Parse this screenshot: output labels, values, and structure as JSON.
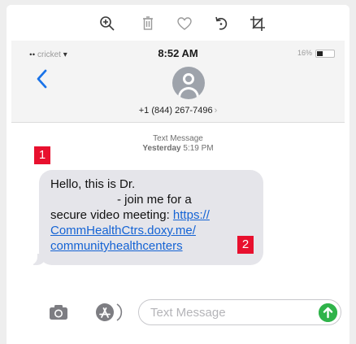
{
  "toolbar": {
    "icons": [
      "zoom-in-icon",
      "trash-icon",
      "heart-icon",
      "rotate-icon",
      "crop-icon"
    ]
  },
  "status_bar": {
    "carrier": "cricket",
    "time": "8:52 AM",
    "battery_percent": "16%"
  },
  "contact": {
    "phone_number": "+1 (844) 267-7496",
    "chevron": "›"
  },
  "thread": {
    "label": "Text Message",
    "day": "Yesterday",
    "time": "5:19 PM"
  },
  "message": {
    "line1": "Hello, this is Dr.",
    "line2": "- join me for a",
    "line3_text": "secure video meeting: ",
    "line3_link": "https://",
    "line4_link": "CommHealthCtrs.doxy.me/",
    "line5_link": "communityhealthcenters"
  },
  "annotations": {
    "badge1": "1",
    "badge2": "2",
    "color": "#e8102e"
  },
  "composer": {
    "placeholder": "Text Message",
    "send_color": "#2fb34a"
  },
  "colors": {
    "link": "#1463d4",
    "back_chevron": "#1a73e8",
    "bubble": "#e5e5ea"
  }
}
